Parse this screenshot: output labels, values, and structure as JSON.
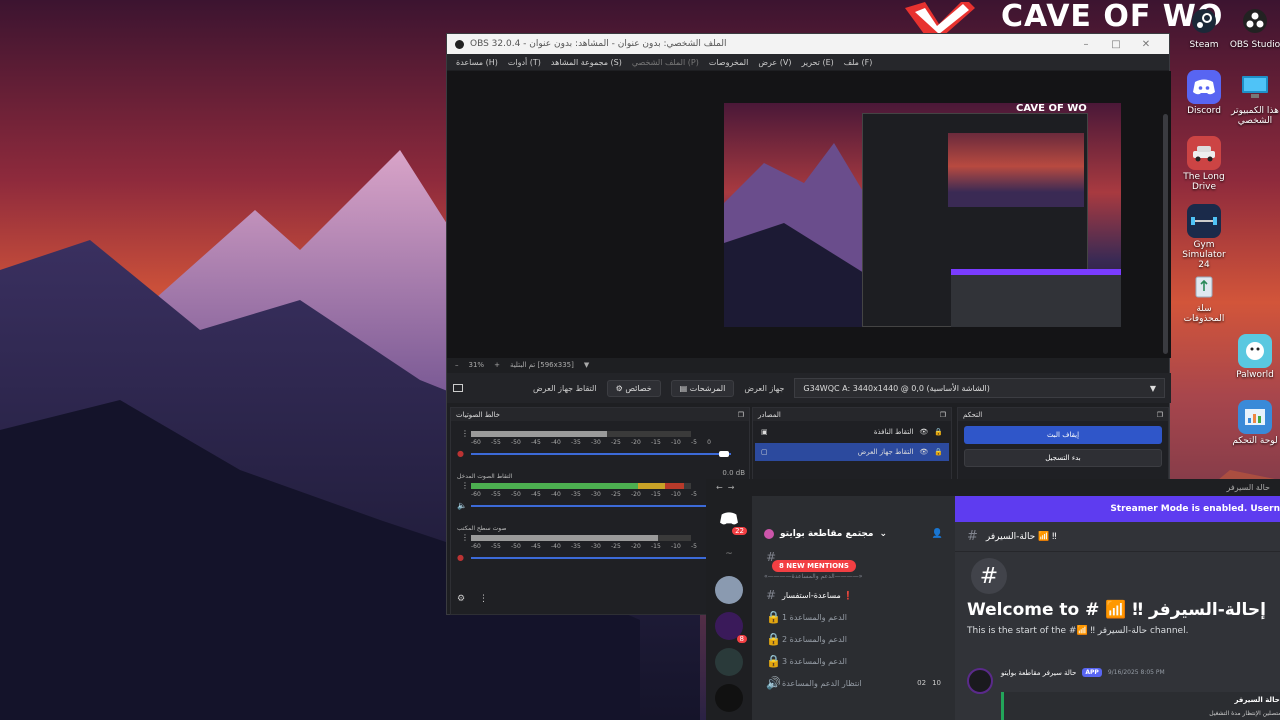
{
  "desktop": {
    "banner_text": "CAVE OF WO",
    "icons": [
      {
        "label": "Steam",
        "icon": "steam-icon"
      },
      {
        "label": "OBS Studio",
        "icon": "obs-icon"
      },
      {
        "label": "Discord",
        "icon": "discord-icon"
      },
      {
        "label": "هذا الكمبيوتر الشخصي",
        "icon": "computer-icon"
      },
      {
        "label": "The Long Drive",
        "icon": "car-icon"
      },
      {
        "label": "Gym Simulator 24",
        "icon": "gym-icon"
      },
      {
        "label": "سلة المحذوفات",
        "icon": "recycle-bin-icon"
      },
      {
        "label": "Palworld",
        "icon": "palworld-icon"
      },
      {
        "label": "لوحة التحكم",
        "icon": "control-panel-icon"
      }
    ]
  },
  "obs": {
    "title": "OBS 32.0.4 - الملف الشخصي: بدون عنوان - المشاهد: بدون عنوان",
    "menu": [
      "ملف (F)",
      "تحرير (E)",
      "عرض (V)",
      "المخروصات",
      "الملف الشخصي (P)",
      "مجموعة المشاهد (S)",
      "أدوات (T)",
      "مساعدة (H)"
    ],
    "zoom": "31%",
    "zoom_detail": "تم البتلية [596x335]",
    "toolbar": {
      "capture_label": "التقاط جهاز العرض",
      "properties_label": "خصائص",
      "filters_label": "المرشحات",
      "display_label": "جهاز العرض",
      "display_value": "G34WQC A: 3440x1440 @ 0,0 (الشاشة الأساسية)"
    },
    "mixer": {
      "title": "خالط الصوتيات",
      "ticks": [
        "-60",
        "-55",
        "-50",
        "-45",
        "-40",
        "-35",
        "-30",
        "-25",
        "-20",
        "-15",
        "-10",
        "-5",
        "0"
      ],
      "tracks": [
        {
          "name": "",
          "db": "",
          "level": 0.62
        },
        {
          "name": "التقاط الصوت المدخل",
          "db": "0.0 dB",
          "level": 0.97
        },
        {
          "name": "صوت سطح المكتب",
          "db": "",
          "level": 0.85
        }
      ]
    },
    "sources": {
      "title": "المصادر",
      "items": [
        {
          "label": "التقاط النافذة",
          "selected": false
        },
        {
          "label": "التقاط جهاز العرض",
          "selected": true
        }
      ]
    },
    "controls": {
      "title": "التحكم",
      "stop_stream": "إيقاف البث",
      "start_recording": "بدء التسجيل"
    }
  },
  "discord": {
    "topbar_right": "حالة السيرفر",
    "streamer_banner": "Streamer Mode is enabled. Usern",
    "server_name": "مجتمع مقاطعة بوايتو",
    "new_mentions": "8 NEW MENTIONS",
    "rail_badge": "22",
    "rail_badge2": "8",
    "category": "«————الدعم والمساعدة————»",
    "channels": [
      {
        "label": "مساعدة-استفسار ❗",
        "type": "text",
        "active": true
      },
      {
        "label": "الدعم والمساعدة 1",
        "type": "voice",
        "active": false
      },
      {
        "label": "الدعم والمساعدة 2",
        "type": "voice",
        "active": false
      },
      {
        "label": "الدعم والمساعدة 3",
        "type": "voice",
        "active": false
      },
      {
        "label": "انتظار الدعم والمساعدة",
        "type": "voice",
        "active": false,
        "count_a": "02",
        "count_b": "10"
      }
    ],
    "channel_title": "حالة-السيرفر 📶 ‼",
    "welcome": "Welcome to # 📶 ‼ إحالة-السيرفر",
    "start_text": "This is the start of the #📶 ‼ حالة-السيرفر channel.",
    "message": {
      "author": "حالة سيرفر مقاطعة بوايتو",
      "tag": "APP",
      "time": "9/16/2025 8:05 PM",
      "embed_title": "حالة السيرفر :",
      "embed_line": "المتصلين     الإنتظار     مدة التشغيل"
    }
  }
}
